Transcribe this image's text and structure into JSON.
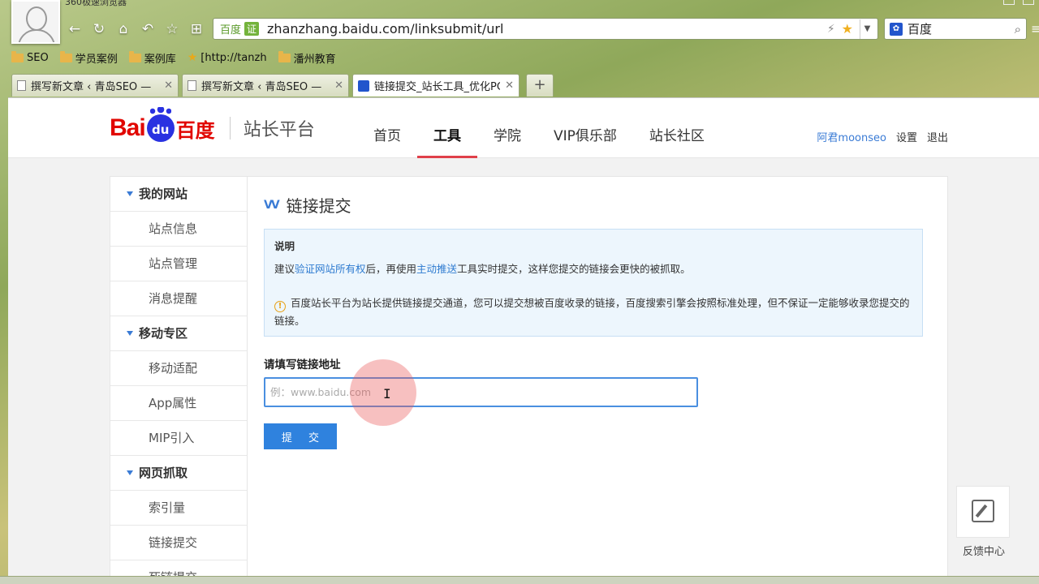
{
  "browser": {
    "window_title": "360极速浏览器",
    "address": {
      "site_tag": "百度",
      "cert_badge": "证",
      "url": "zhanzhang.baidu.com/linksubmit/url"
    },
    "search": {
      "engine": "百度"
    },
    "bookmarks": [
      {
        "label": "SEO"
      },
      {
        "label": "学员案例"
      },
      {
        "label": "案例库"
      },
      {
        "label": "[http://tanzh"
      },
      {
        "label": "潘州教育"
      }
    ],
    "tabs": [
      {
        "title": "撰写新文章 ‹ 青岛SEO —"
      },
      {
        "title": "撰写新文章 ‹ 青岛SEO —"
      },
      {
        "title": "链接提交_站长工具_优化PC",
        "active": true
      }
    ],
    "new_tab": "+"
  },
  "header": {
    "logo": {
      "bai": "Bai",
      "du": "du",
      "cn": "百度",
      "platform": "站长平台"
    },
    "nav": [
      {
        "label": "首页"
      },
      {
        "label": "工具",
        "active": true
      },
      {
        "label": "学院"
      },
      {
        "label": "VIP俱乐部"
      },
      {
        "label": "站长社区"
      }
    ],
    "user": {
      "name": "阿君moonseo",
      "settings": "设置",
      "logout": "退出"
    }
  },
  "sidebar": {
    "groups": [
      {
        "label": "我的网站",
        "items": [
          "站点信息",
          "站点管理",
          "消息提醒"
        ]
      },
      {
        "label": "移动专区",
        "items": [
          "移动适配",
          "App属性",
          "MIP引入"
        ]
      },
      {
        "label": "网页抓取",
        "items": [
          "索引量",
          "链接提交",
          "死链提交"
        ]
      }
    ]
  },
  "main": {
    "title": "链接提交",
    "notice": {
      "heading": "说明",
      "line1_pre": "建议",
      "line1_link1": "验证网站所有权",
      "line1_mid": "后，再使用",
      "line1_link2": "主动推送",
      "line1_post": "工具实时提交，这样您提交的链接会更快的被抓取。",
      "warning": "百度站长平台为站长提供链接提交通道，您可以提交想被百度收录的链接，百度搜索引擎会按照标准处理，但不保证一定能够收录您提交的链接。"
    },
    "form": {
      "label": "请填写链接地址",
      "placeholder": "例：www.baidu.com",
      "value": "",
      "submit": "提 交"
    }
  },
  "feedback": {
    "label": "反馈中心"
  },
  "colors": {
    "brand_red": "#e10601",
    "brand_blue": "#2932e1",
    "link": "#2e7bd0",
    "button": "#2f82de",
    "nav_active_underline": "#e0404a"
  }
}
